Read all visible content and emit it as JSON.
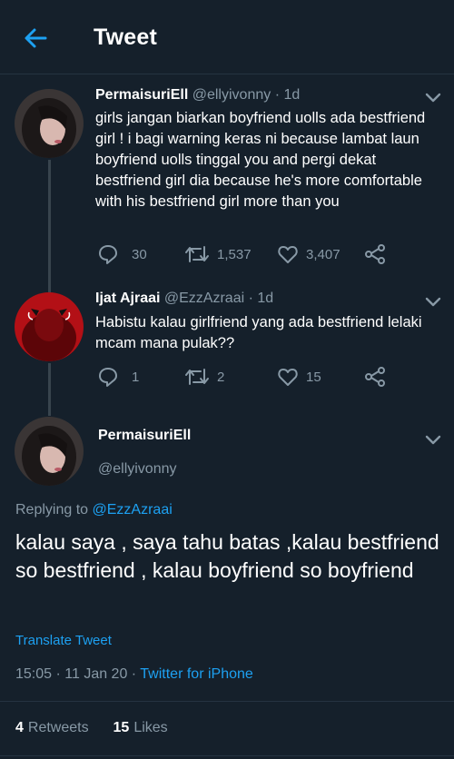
{
  "header": {
    "title": "Tweet"
  },
  "tweets": [
    {
      "name": "PermaisuriEll",
      "handle": "@ellyivonny",
      "time": "1d",
      "text": "girls jangan biarkan boyfriend uolls ada bestfriend girl ! i bagi warning keras ni because lambat laun boyfriend uolls tinggal you and pergi dekat bestfriend girl dia because he's more comfortable with his bestfriend girl more than you",
      "replies": "30",
      "retweets": "1,537",
      "likes": "3,407"
    },
    {
      "name": "Ijat Ajraai",
      "handle": "@EzzAzraai",
      "time": "1d",
      "text": "Habistu kalau girlfriend yang ada bestfriend lelaki mcam mana pulak??",
      "replies": "1",
      "retweets": "2",
      "likes": "15"
    }
  ],
  "main": {
    "name": "PermaisuriEll",
    "handle": "@ellyivonny",
    "replying_prefix": "Replying to",
    "replying_to": "@EzzAzraai",
    "text": "kalau saya , saya tahu batas ,kalau bestfriend so bestfriend , kalau boyfriend so boyfriend",
    "translate": "Translate Tweet",
    "timestamp": "15:05 · 11 Jan 20 · ",
    "source": "Twitter for iPhone",
    "retweets_count": "4",
    "retweets_label": "Retweets",
    "likes_count": "15",
    "likes_label": "Likes"
  },
  "colors": {
    "background": "#15202b",
    "accent": "#1da1f2",
    "secondary_text": "#8899a6",
    "divider": "#253341"
  }
}
